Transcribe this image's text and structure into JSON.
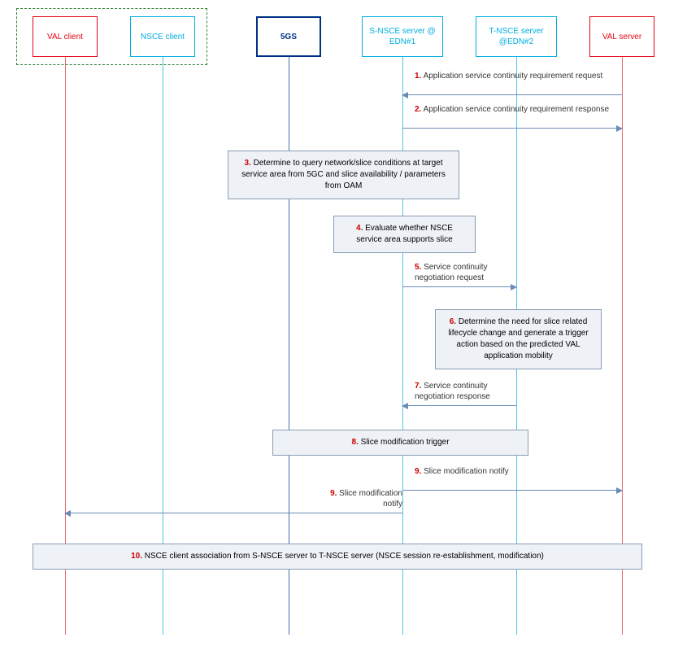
{
  "participants": {
    "val_client": "VAL client",
    "nsce_client": "NSCE client",
    "fgs": "5GS",
    "s_nsce": "S-NSCE server @ EDN#1",
    "t_nsce": "T-NSCE server @EDN#2",
    "val_server": "VAL server"
  },
  "messages": {
    "m1_num": "1.",
    "m1_text": " Application service continuity requirement request",
    "m2_num": "2.",
    "m2_text": " Application service continuity requirement response",
    "m3_num": "3.",
    "m3_text": " Determine to query network/slice conditions at target service area from 5GC and slice availability / parameters from OAM",
    "m4_num": "4.",
    "m4_text": " Evaluate whether NSCE service area supports slice",
    "m5_num": "5.",
    "m5_text": " Service continuity negotiation request",
    "m6_num": "6.",
    "m6_text": " Determine the need for slice related lifecycle change and generate a trigger action based on the predicted VAL application mobility",
    "m7_num": "7.",
    "m7_text": " Service continuity negotiation response",
    "m8_num": "8.",
    "m8_text": " Slice modification trigger",
    "m9_num": "9.",
    "m9_text": " Slice modification notify",
    "m9b_num": "9.",
    "m9b_text": " Slice modification notify",
    "m10_num": "10.",
    "m10_text": " NSCE client association from S-NSCE server to T-NSCE server (NSCE session re-establishment, modification)"
  }
}
